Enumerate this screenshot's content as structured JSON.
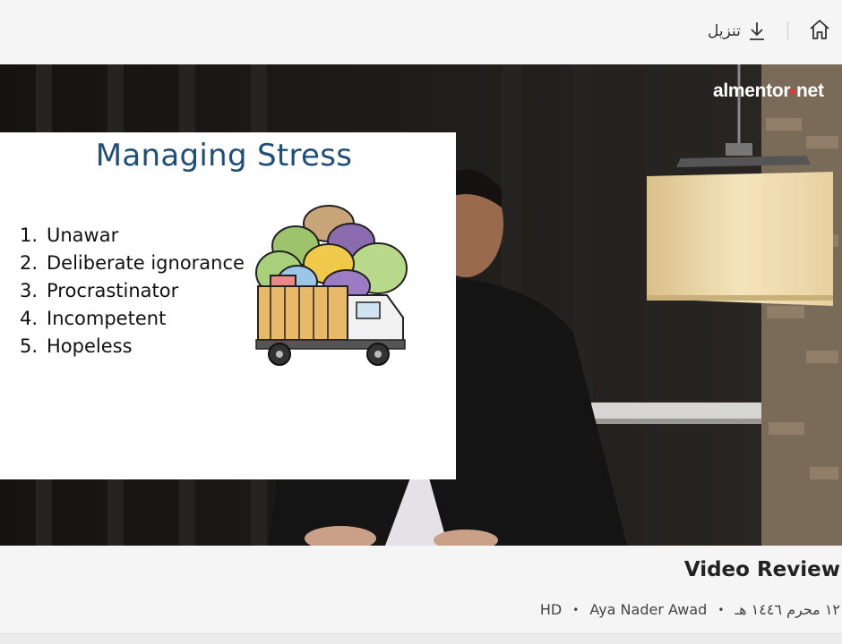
{
  "topbar": {
    "home_icon": "home-icon",
    "download_label": "تنزيل",
    "download_icon": "download-icon"
  },
  "video": {
    "logo_text_a": "almentor",
    "logo_text_b": "net",
    "slide": {
      "title": "Managing Stress",
      "items": [
        {
          "num": "1.",
          "label": "Unawar"
        },
        {
          "num": "2.",
          "label": "Deliberate ignorance"
        },
        {
          "num": "3.",
          "label": "Procrastinator"
        },
        {
          "num": "4.",
          "label": "Incompetent"
        },
        {
          "num": "5.",
          "label": "Hopeless"
        }
      ],
      "illustration": "overloaded-truck-illustration"
    }
  },
  "info": {
    "title": "Video Review",
    "date": "١٢ محرم ١٤٤٦ هـ",
    "author": "Aya Nader Awad",
    "quality": "HD"
  }
}
